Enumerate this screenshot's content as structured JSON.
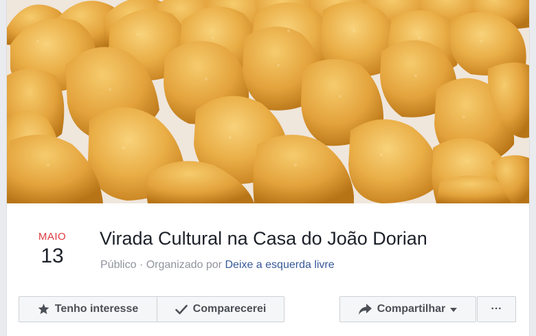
{
  "event": {
    "month": "MAIO",
    "day": "13",
    "title": "Virada Cultural na Casa do João Dorian",
    "privacy": "Público",
    "organized_by_label": "· Organizado por",
    "organizer": "Deixe a esquerda livre"
  },
  "actions": {
    "interested_label": "Tenho interesse",
    "going_label": "Comparecerei",
    "share_label": "Compartilhar",
    "more_label": "···"
  },
  "icons": {
    "interested": "star-icon",
    "going": "checkmark-icon",
    "share": "share-arrow-icon",
    "share_dropdown": "caret-down-icon"
  },
  "colors": {
    "month_red": "#e0393e",
    "link_blue": "#365899",
    "button_bg": "#f5f6f7",
    "button_border": "#ccd0d5"
  }
}
